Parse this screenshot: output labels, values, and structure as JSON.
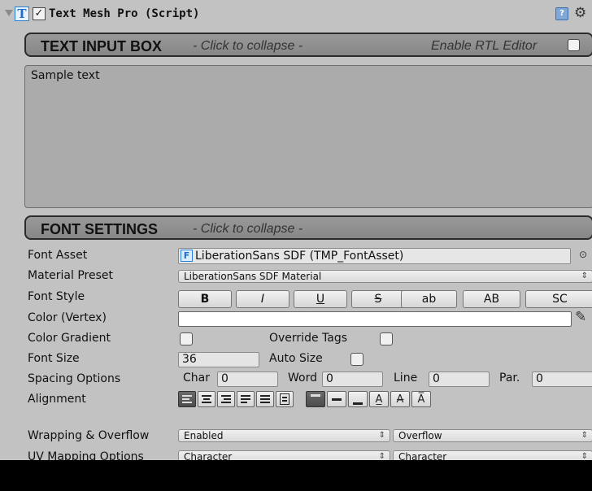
{
  "component": {
    "title": "Text Mesh Pro (Script)",
    "enabled": true,
    "icon": "tmp-text-icon"
  },
  "text_input_section": {
    "title": "TEXT INPUT BOX",
    "hint": "- Click to collapse -",
    "rtl_label": "Enable RTL Editor",
    "rtl_enabled": false,
    "text": "Sample text"
  },
  "font_settings_section": {
    "title": "FONT SETTINGS",
    "hint": "- Click to collapse -"
  },
  "properties": {
    "font_asset": {
      "label": "Font Asset",
      "value": "LiberationSans SDF (TMP_FontAsset)",
      "icon": "font-asset-icon"
    },
    "material_preset": {
      "label": "Material Preset",
      "value": "LiberationSans SDF Material"
    },
    "font_style": {
      "label": "Font Style",
      "buttons": [
        "B",
        "I",
        "U",
        "S",
        "ab",
        "AB",
        "SC"
      ]
    },
    "color": {
      "label": "Color (Vertex)",
      "value": "#FFFFFF"
    },
    "color_gradient": {
      "label": "Color Gradient",
      "enabled": false,
      "override_label": "Override Tags",
      "override_enabled": false
    },
    "font_size": {
      "label": "Font Size",
      "value": "36",
      "auto_label": "Auto Size",
      "auto_enabled": false
    },
    "spacing": {
      "label": "Spacing Options",
      "char_label": "Char",
      "char_value": "0",
      "word_label": "Word",
      "word_value": "0",
      "line_label": "Line",
      "line_value": "0",
      "par_label": "Par.",
      "par_value": "0"
    },
    "alignment": {
      "label": "Alignment",
      "horizontal": [
        "left",
        "center",
        "right",
        "justified",
        "flush",
        "geometry-center"
      ],
      "horizontal_selected": "left",
      "vertical": [
        "top",
        "middle",
        "bottom",
        "baseline",
        "midline",
        "capline"
      ],
      "vertical_selected": "top"
    },
    "wrapping": {
      "label": "Wrapping & Overflow",
      "wrap_value": "Enabled",
      "overflow_value": "Overflow"
    },
    "uv_mapping": {
      "label": "UV Mapping Options",
      "horizontal_value": "Character",
      "vertical_value": "Character"
    }
  }
}
